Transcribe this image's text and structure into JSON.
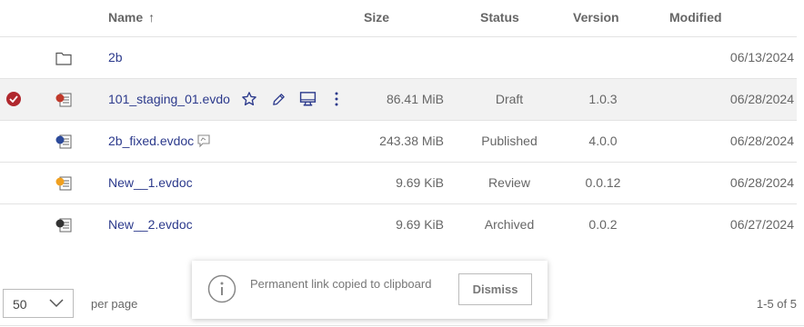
{
  "table": {
    "headers": {
      "name": "Name",
      "sort_arrow": "↑",
      "size": "Size",
      "status": "Status",
      "version": "Version",
      "modified": "Modified"
    },
    "rows": [
      {
        "type": "folder",
        "icon": "folder-icon",
        "name": "2b",
        "size": "",
        "status": "",
        "version": "",
        "modified": "06/13/2024"
      },
      {
        "type": "file",
        "icon": "evdoc-red-icon",
        "icon_color": "#c0392b",
        "selected": true,
        "name": "101_staging_01.evdo",
        "size": "86.41 MiB",
        "status": "Draft",
        "version": "1.0.3",
        "modified": "06/28/2024"
      },
      {
        "type": "file",
        "icon": "evdoc-blue-icon",
        "icon_color": "#2c4a9a",
        "name": "2b_fixed.evdoc",
        "size": "243.38 MiB",
        "status": "Published",
        "version": "4.0.0",
        "modified": "06/28/2024"
      },
      {
        "type": "file",
        "icon": "evdoc-yellow-icon",
        "icon_color": "#f0a020",
        "name": "New__1.evdoc",
        "size": "9.69 KiB",
        "status": "Review",
        "version": "0.0.12",
        "modified": "06/28/2024"
      },
      {
        "type": "file",
        "icon": "evdoc-dark-icon",
        "icon_color": "#333333",
        "name": "New__2.evdoc",
        "size": "9.69 KiB",
        "status": "Archived",
        "version": "0.0.2",
        "modified": "06/27/2024"
      }
    ]
  },
  "row_actions": [
    "star-icon",
    "pencil-icon",
    "monitor-icon",
    "more-vertical-icon"
  ],
  "pagination": {
    "per_page_value": "50",
    "per_page_label": "per page",
    "range": "1-5 of 5"
  },
  "toast": {
    "message": "Permanent link copied to clipboard",
    "dismiss_label": "Dismiss"
  },
  "colors": {
    "link": "#2c3a8c",
    "selected_check": "#b0282e",
    "action_icons": "#2c3a8c"
  }
}
